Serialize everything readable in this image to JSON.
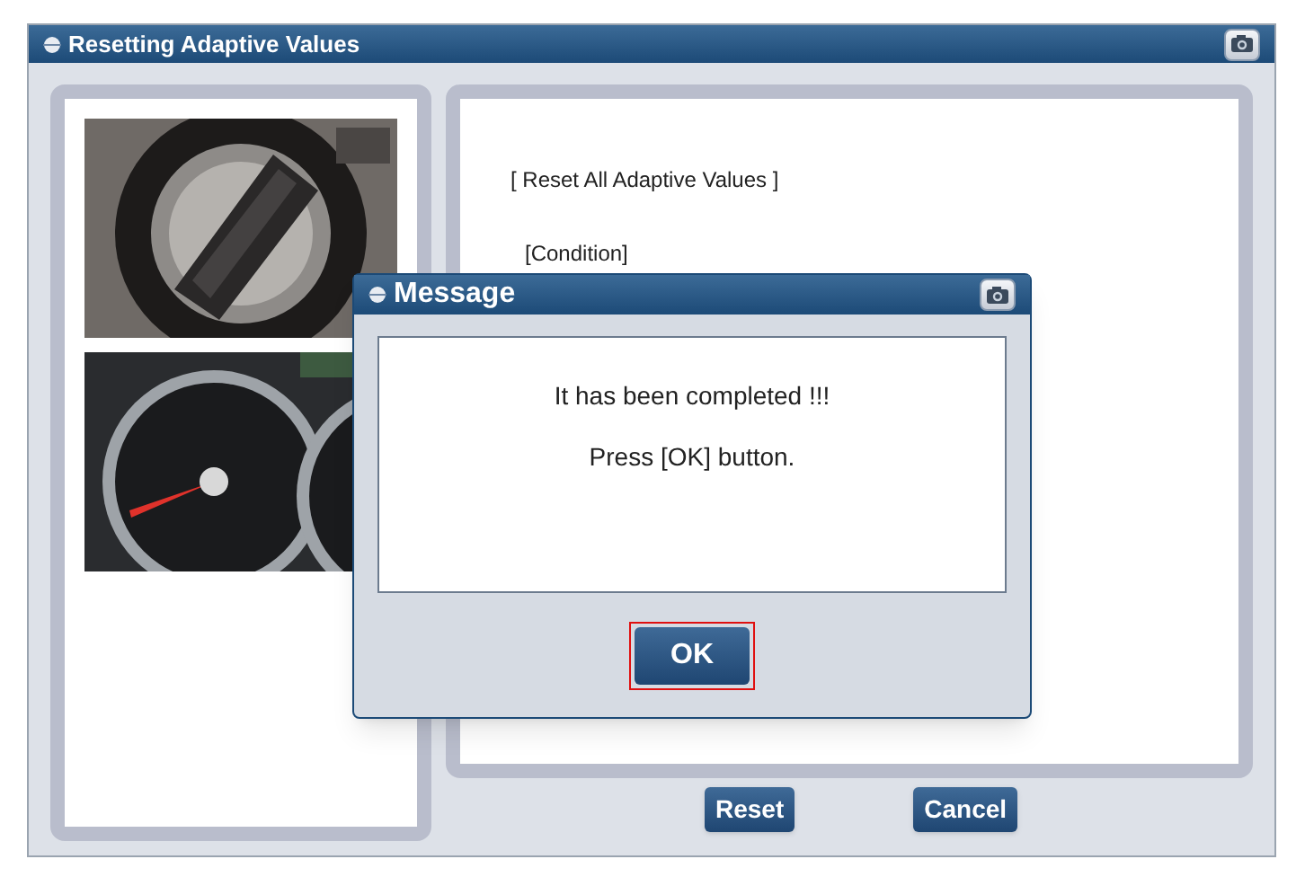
{
  "window": {
    "title": "Resetting Adaptive Values"
  },
  "content": {
    "heading": "[ Reset All Adaptive Values ]",
    "condition": "[Condition]"
  },
  "buttons": [
    {
      "label": "Reset"
    },
    {
      "label": "Cancel"
    }
  ],
  "dialog": {
    "title": "Message",
    "lines": [
      "It has been completed !!!",
      "Press [OK] button."
    ],
    "button": {
      "label": "OK",
      "focused": true
    }
  }
}
